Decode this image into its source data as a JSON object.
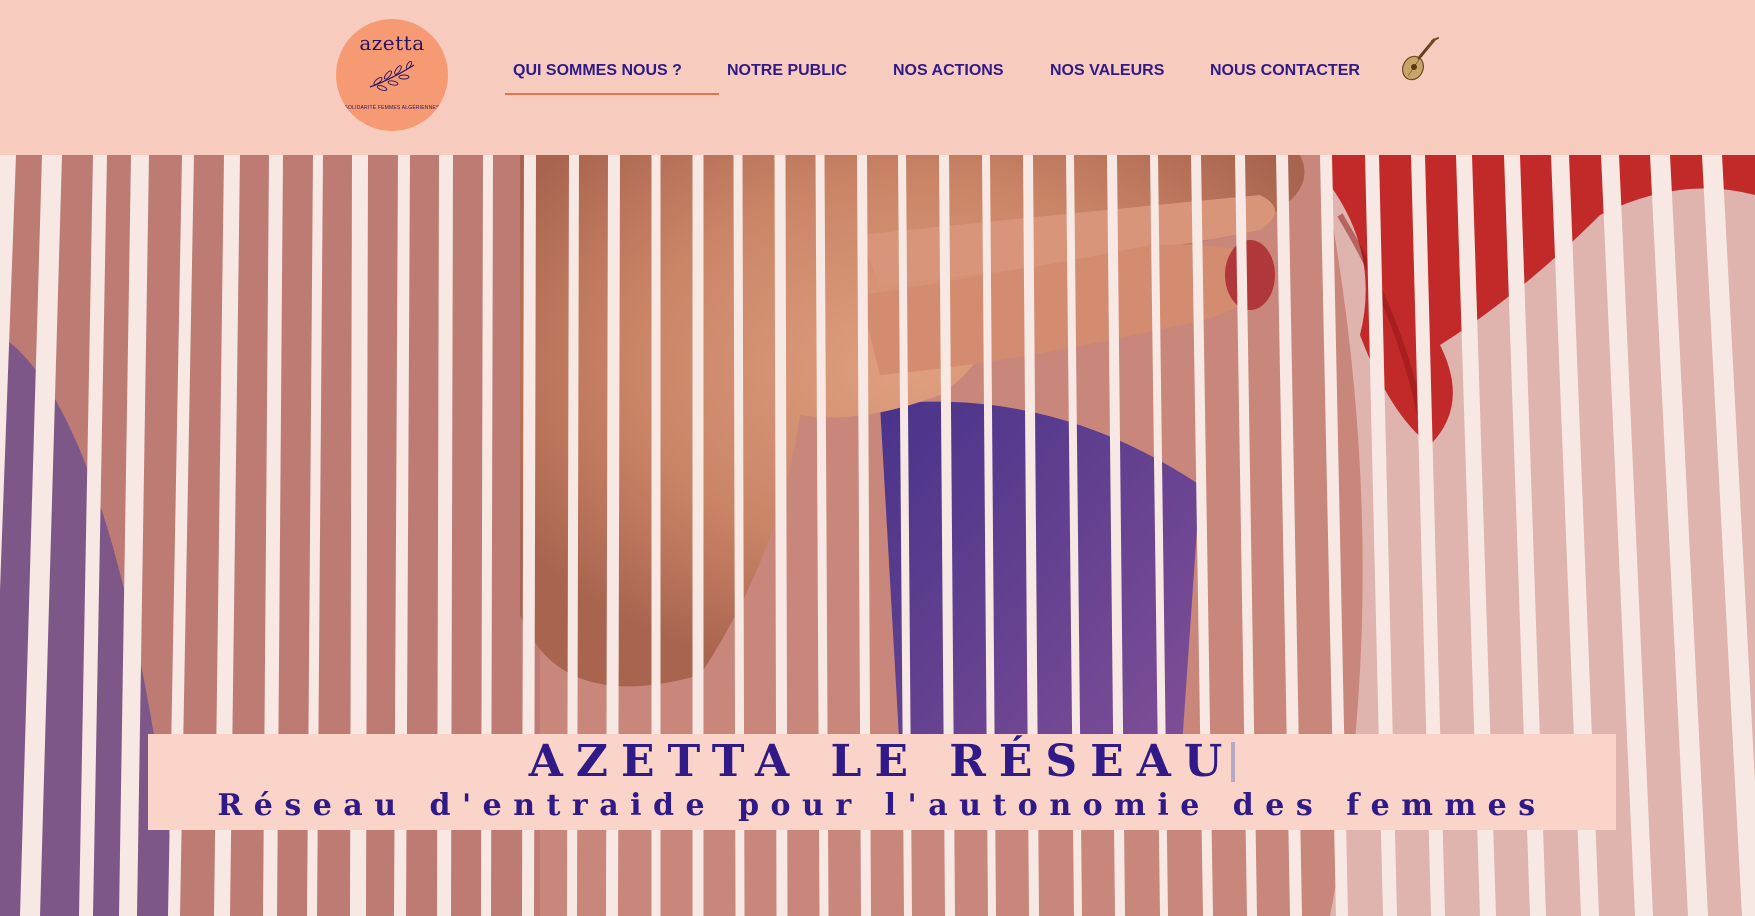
{
  "header": {
    "logo": {
      "word": "azetta",
      "tagline": "SOLIDARITÉ FEMMES ALGÉRIENNES",
      "icon": "olive-branch-icon"
    },
    "nav": [
      {
        "label": "QUI SOMMES NOUS ?",
        "active": true
      },
      {
        "label": "NOTRE PUBLIC",
        "active": false
      },
      {
        "label": "NOS ACTIONS",
        "active": false
      },
      {
        "label": "NOS VALEURS",
        "active": false
      },
      {
        "label": "NOUS CONTACTER",
        "active": false
      }
    ],
    "extra_icon": "lute-icon"
  },
  "hero": {
    "image": "weaving-loom-hand-photo",
    "title": "AZETTA LE RÉSEAU",
    "subtitle": "Réseau d'entraide pour l'autonomie des femmes"
  },
  "colors": {
    "background": "#f8cbbf",
    "nav_text": "#2f1a87",
    "accent": "#e8714f",
    "logo_circle": "#f69a73",
    "banner_bg": "#fbd4c9"
  }
}
